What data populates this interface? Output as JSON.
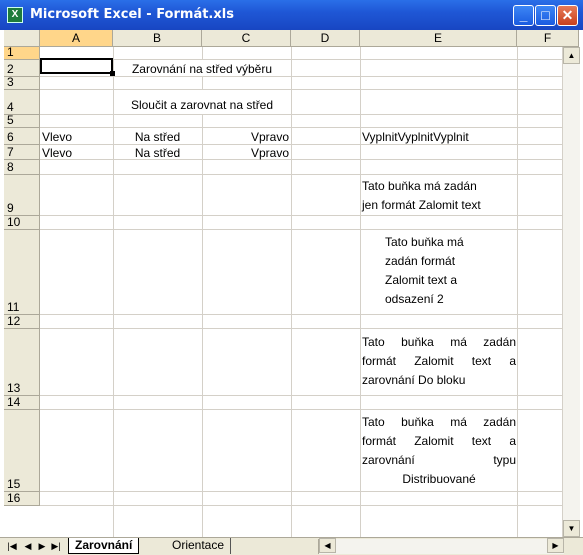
{
  "window": {
    "title": "Microsoft Excel - Formát.xls"
  },
  "columns": [
    "A",
    "B",
    "C",
    "D",
    "E",
    "F"
  ],
  "rows": [
    "1",
    "2",
    "3",
    "4",
    "5",
    "6",
    "7",
    "8",
    "9",
    "10",
    "11",
    "12",
    "13",
    "14",
    "15",
    "16"
  ],
  "cells": {
    "B2": "Zarovnání na střed výběru",
    "B4": "Sloučit a zarovnat na střed",
    "A6": "Vlevo",
    "B6": "Na střed",
    "C6": "Vpravo",
    "E6": "VyplnitVyplnitVyplnit",
    "A7": "Vlevo",
    "B7": "Na střed",
    "C7": "Vpravo",
    "E9": [
      "Tato buňka má zadán",
      "jen formát Zalomit text"
    ],
    "E11": [
      "Tato buňka má",
      "zadán formát",
      "Zalomit text a",
      "odsazení 2"
    ],
    "E13": [
      "Tato buňka má zadán",
      "formát Zalomit text a",
      "zarovnání Do bloku"
    ],
    "E15": [
      "Tato buňka má zadán",
      "formát Zalomit text a",
      "zarovnání typu",
      "Distribuované"
    ]
  },
  "tabs": [
    "Zarovnání",
    "Orientace"
  ],
  "active_tab": "Zarovnání",
  "active_cell": "A1"
}
